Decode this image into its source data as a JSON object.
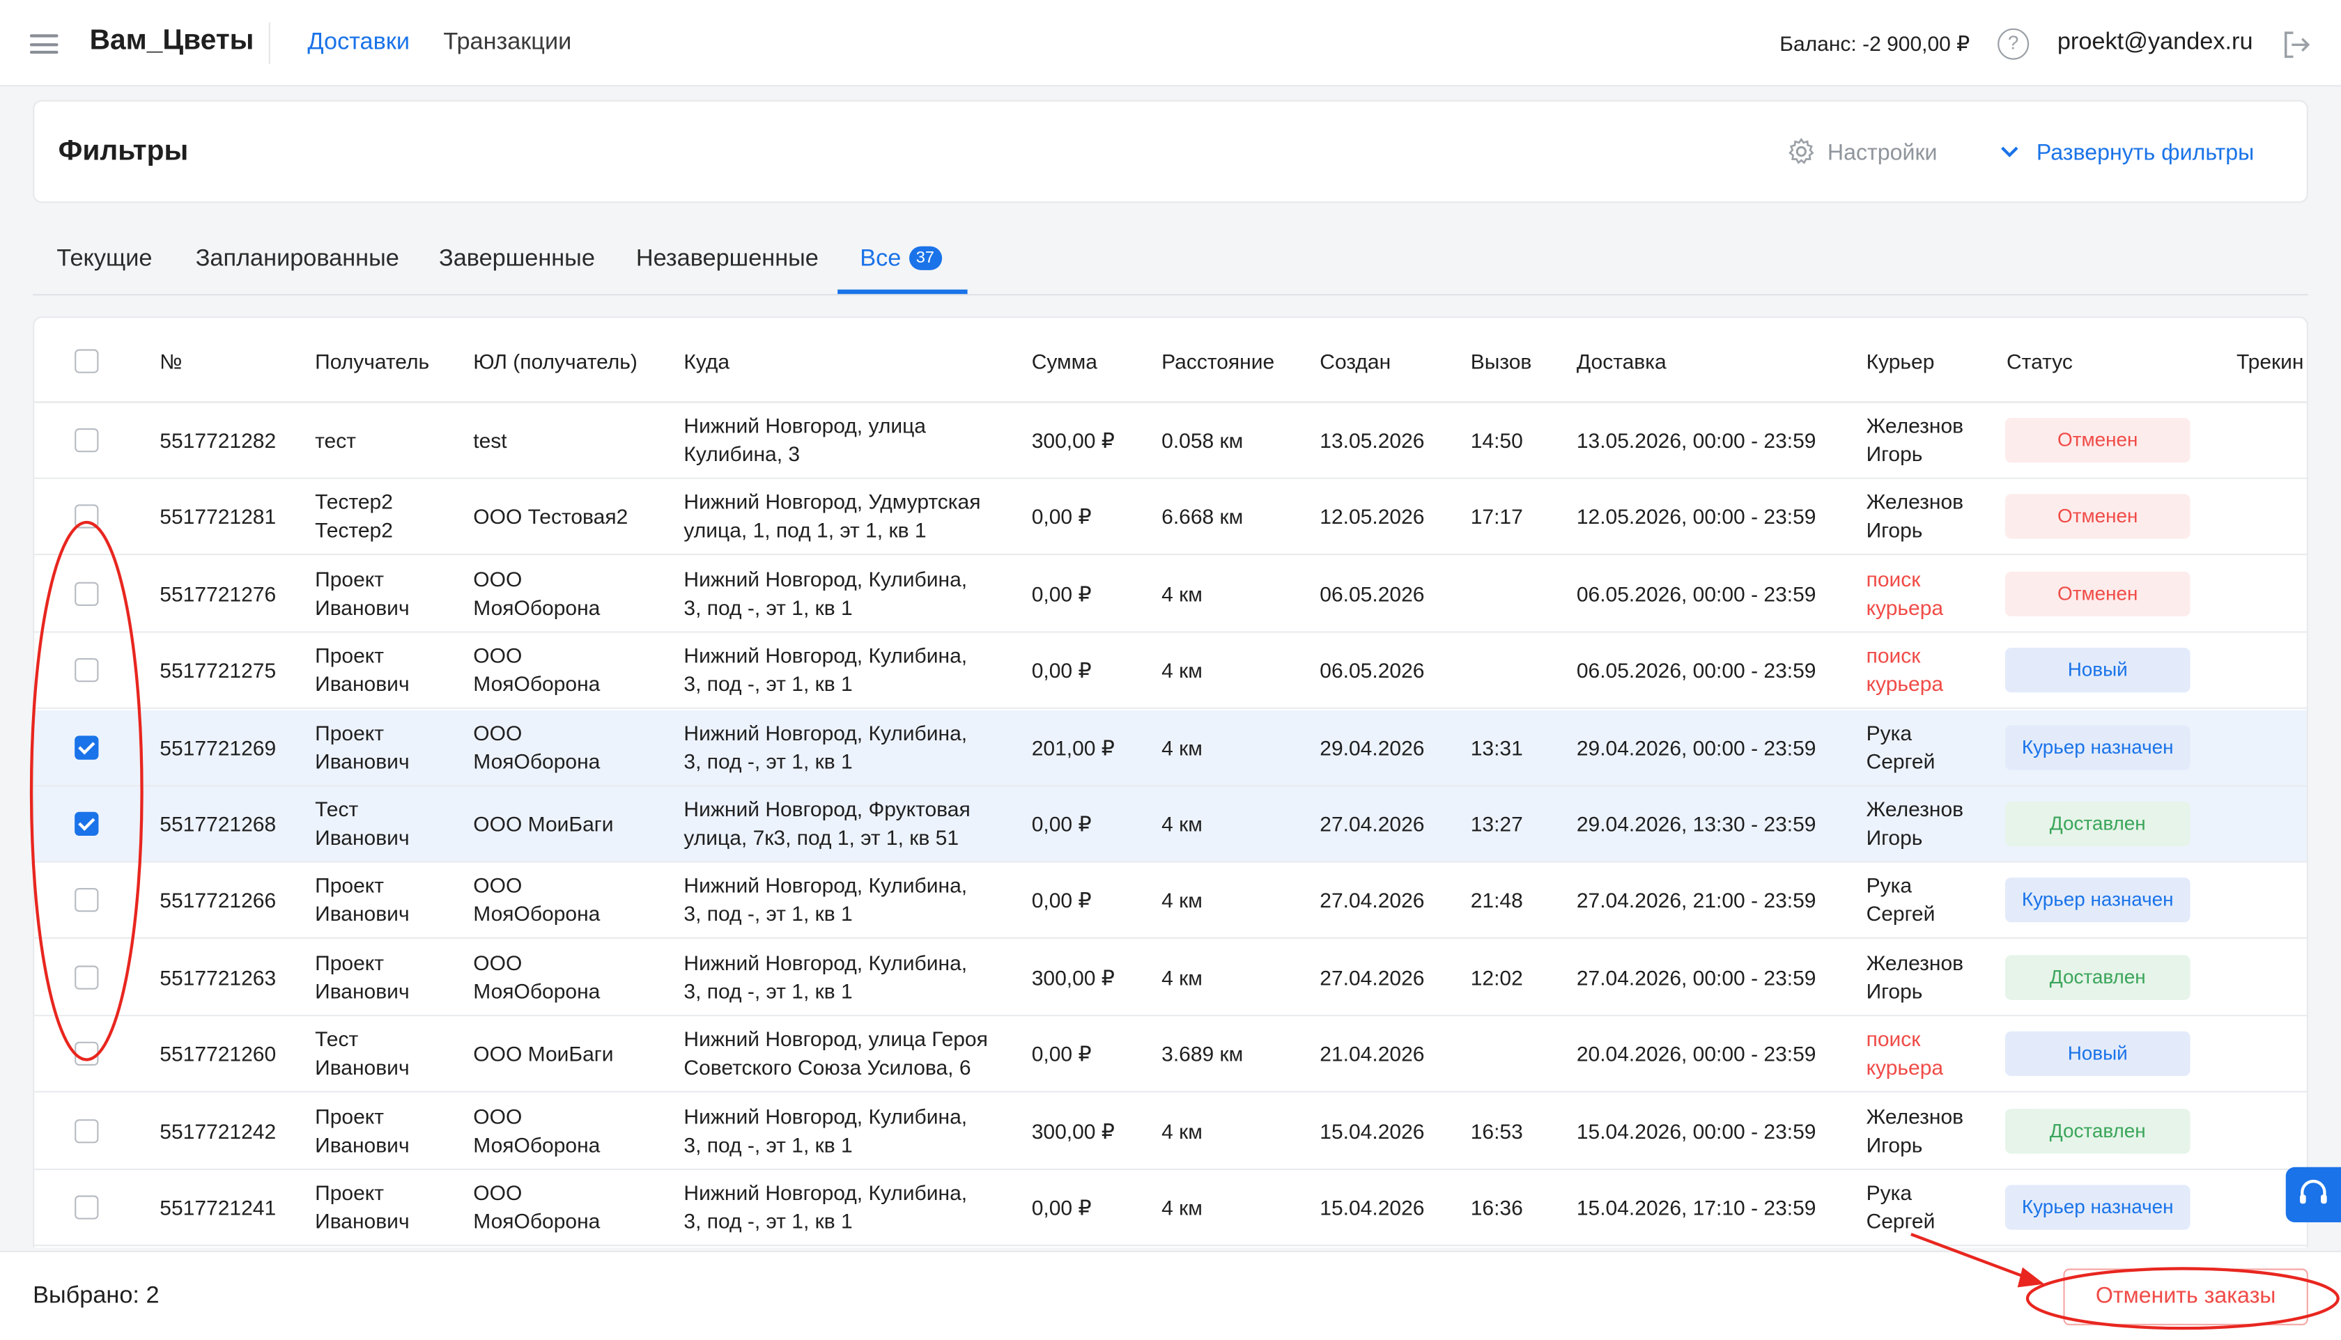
{
  "header": {
    "brand": "Вам_Цветы",
    "nav": [
      "Доставки",
      "Транзакции"
    ],
    "balance": "Баланс: -2 900,00 ₽",
    "help": "?",
    "email": "proekt@yandex.ru"
  },
  "filters": {
    "title": "Фильтры",
    "settings": "Настройки",
    "expand": "Развернуть фильтры"
  },
  "tabs": {
    "items": [
      "Текущие",
      "Запланированные",
      "Завершенные",
      "Незавершенные",
      "Все"
    ],
    "count": "37"
  },
  "table": {
    "columns": [
      "№",
      "Получатель",
      "ЮЛ (получатель)",
      "Куда",
      "Сумма",
      "Расстояние",
      "Создан",
      "Вызов",
      "Доставка",
      "Курьер",
      "Статус",
      "Трекин"
    ],
    "rows": [
      {
        "checked": false,
        "num": "5517721282",
        "recipient": [
          "тест"
        ],
        "org": [
          "test"
        ],
        "address": [
          "Нижний Новгород, улица",
          "Кулибина, 3"
        ],
        "sum": "300,00 ₽",
        "distance": "0.058 км",
        "created": "13.05.2026",
        "call": "14:50",
        "delivery": "13.05.2026, 00:00 - 23:59",
        "courier": [
          "Железнов",
          "Игорь"
        ],
        "courier_searching": false,
        "status": "Отменен"
      },
      {
        "checked": false,
        "num": "5517721281",
        "recipient": [
          "Тестер2",
          "Тестер2"
        ],
        "org": [
          "ООО Тестовая2"
        ],
        "address": [
          "Нижний Новгород, Удмуртская",
          "улица, 1, под 1, эт 1, кв 1"
        ],
        "sum": "0,00 ₽",
        "distance": "6.668 км",
        "created": "12.05.2026",
        "call": "17:17",
        "delivery": "12.05.2026, 00:00 - 23:59",
        "courier": [
          "Железнов",
          "Игорь"
        ],
        "courier_searching": false,
        "status": "Отменен"
      },
      {
        "checked": false,
        "num": "5517721276",
        "recipient": [
          "Проект",
          "Иванович"
        ],
        "org": [
          "ООО",
          "МояОборона"
        ],
        "address": [
          "Нижний Новгород, Кулибина,",
          "3, под -, эт 1, кв 1"
        ],
        "sum": "0,00 ₽",
        "distance": "4 км",
        "created": "06.05.2026",
        "call": "",
        "delivery": "06.05.2026, 00:00 - 23:59",
        "courier": [
          "поиск",
          "курьера"
        ],
        "courier_searching": true,
        "status": "Отменен"
      },
      {
        "checked": false,
        "num": "5517721275",
        "recipient": [
          "Проект",
          "Иванович"
        ],
        "org": [
          "ООО",
          "МояОборона"
        ],
        "address": [
          "Нижний Новгород, Кулибина,",
          "3, под -, эт 1, кв 1"
        ],
        "sum": "0,00 ₽",
        "distance": "4 км",
        "created": "06.05.2026",
        "call": "",
        "delivery": "06.05.2026, 00:00 - 23:59",
        "courier": [
          "поиск",
          "курьера"
        ],
        "courier_searching": true,
        "status": "Новый"
      },
      {
        "checked": true,
        "num": "5517721269",
        "recipient": [
          "Проект",
          "Иванович"
        ],
        "org": [
          "ООО",
          "МояОборона"
        ],
        "address": [
          "Нижний Новгород, Кулибина,",
          "3, под -, эт 1, кв 1"
        ],
        "sum": "201,00 ₽",
        "distance": "4 км",
        "created": "29.04.2026",
        "call": "13:31",
        "delivery": "29.04.2026, 00:00 - 23:59",
        "courier": [
          "Рука",
          "Сергей"
        ],
        "courier_searching": false,
        "status": "Курьер назначен"
      },
      {
        "checked": true,
        "num": "5517721268",
        "recipient": [
          "Тест",
          "Иванович"
        ],
        "org": [
          "ООО МоиБаги"
        ],
        "address": [
          "Нижний Новгород, Фруктовая",
          "улица, 7к3, под 1, эт 1, кв 51"
        ],
        "sum": "0,00 ₽",
        "distance": "4 км",
        "created": "27.04.2026",
        "call": "13:27",
        "delivery": "29.04.2026, 13:30 - 23:59",
        "courier": [
          "Железнов",
          "Игорь"
        ],
        "courier_searching": false,
        "status": "Доставлен"
      },
      {
        "checked": false,
        "num": "5517721266",
        "recipient": [
          "Проект",
          "Иванович"
        ],
        "org": [
          "ООО",
          "МояОборона"
        ],
        "address": [
          "Нижний Новгород, Кулибина,",
          "3, под -, эт 1, кв 1"
        ],
        "sum": "0,00 ₽",
        "distance": "4 км",
        "created": "27.04.2026",
        "call": "21:48",
        "delivery": "27.04.2026, 21:00 - 23:59",
        "courier": [
          "Рука",
          "Сергей"
        ],
        "courier_searching": false,
        "status": "Курьер назначен"
      },
      {
        "checked": false,
        "num": "5517721263",
        "recipient": [
          "Проект",
          "Иванович"
        ],
        "org": [
          "ООО",
          "МояОборона"
        ],
        "address": [
          "Нижний Новгород, Кулибина,",
          "3, под -, эт 1, кв 1"
        ],
        "sum": "300,00 ₽",
        "distance": "4 км",
        "created": "27.04.2026",
        "call": "12:02",
        "delivery": "27.04.2026, 00:00 - 23:59",
        "courier": [
          "Железнов",
          "Игорь"
        ],
        "courier_searching": false,
        "status": "Доставлен"
      },
      {
        "checked": false,
        "num": "5517721260",
        "recipient": [
          "Тест",
          "Иванович"
        ],
        "org": [
          "ООО МоиБаги"
        ],
        "address": [
          "Нижний Новгород, улица Героя",
          "Советского Союза Усилова, 6"
        ],
        "sum": "0,00 ₽",
        "distance": "3.689 км",
        "created": "21.04.2026",
        "call": "",
        "delivery": "20.04.2026, 00:00 - 23:59",
        "courier": [
          "поиск",
          "курьера"
        ],
        "courier_searching": true,
        "status": "Новый"
      },
      {
        "checked": false,
        "num": "5517721242",
        "recipient": [
          "Проект",
          "Иванович"
        ],
        "org": [
          "ООО",
          "МояОборона"
        ],
        "address": [
          "Нижний Новгород, Кулибина,",
          "3, под -, эт 1, кв 1"
        ],
        "sum": "300,00 ₽",
        "distance": "4 км",
        "created": "15.04.2026",
        "call": "16:53",
        "delivery": "15.04.2026, 00:00 - 23:59",
        "courier": [
          "Железнов",
          "Игорь"
        ],
        "courier_searching": false,
        "status": "Доставлен"
      },
      {
        "checked": false,
        "num": "5517721241",
        "recipient": [
          "Проект",
          "Иванович"
        ],
        "org": [
          "ООО",
          "МояОборона"
        ],
        "address": [
          "Нижний Новгород, Кулибина,",
          "3, под -, эт 1, кв 1"
        ],
        "sum": "0,00 ₽",
        "distance": "4 км",
        "created": "15.04.2026",
        "call": "16:36",
        "delivery": "15.04.2026, 17:10 - 23:59",
        "courier": [
          "Рука",
          "Сергей"
        ],
        "courier_searching": false,
        "status": "Курьер назначен"
      }
    ]
  },
  "footer": {
    "selected": "Выбрано: 2",
    "cancel_label": "Отменить заказы"
  },
  "colors": {
    "accent": "#1a73e8",
    "danger": "#f04b47",
    "annotation": "#e8261f",
    "status_cancelled": {
      "bg": "#fdecec",
      "fg": "#f04b47"
    },
    "status_new": {
      "bg": "#e3ebfb",
      "fg": "#1a73e8"
    },
    "status_assigned": {
      "bg": "#e3ebfb",
      "fg": "#1a73e8"
    },
    "status_delivered": {
      "bg": "#e6f4e9",
      "fg": "#3aa55a"
    }
  }
}
